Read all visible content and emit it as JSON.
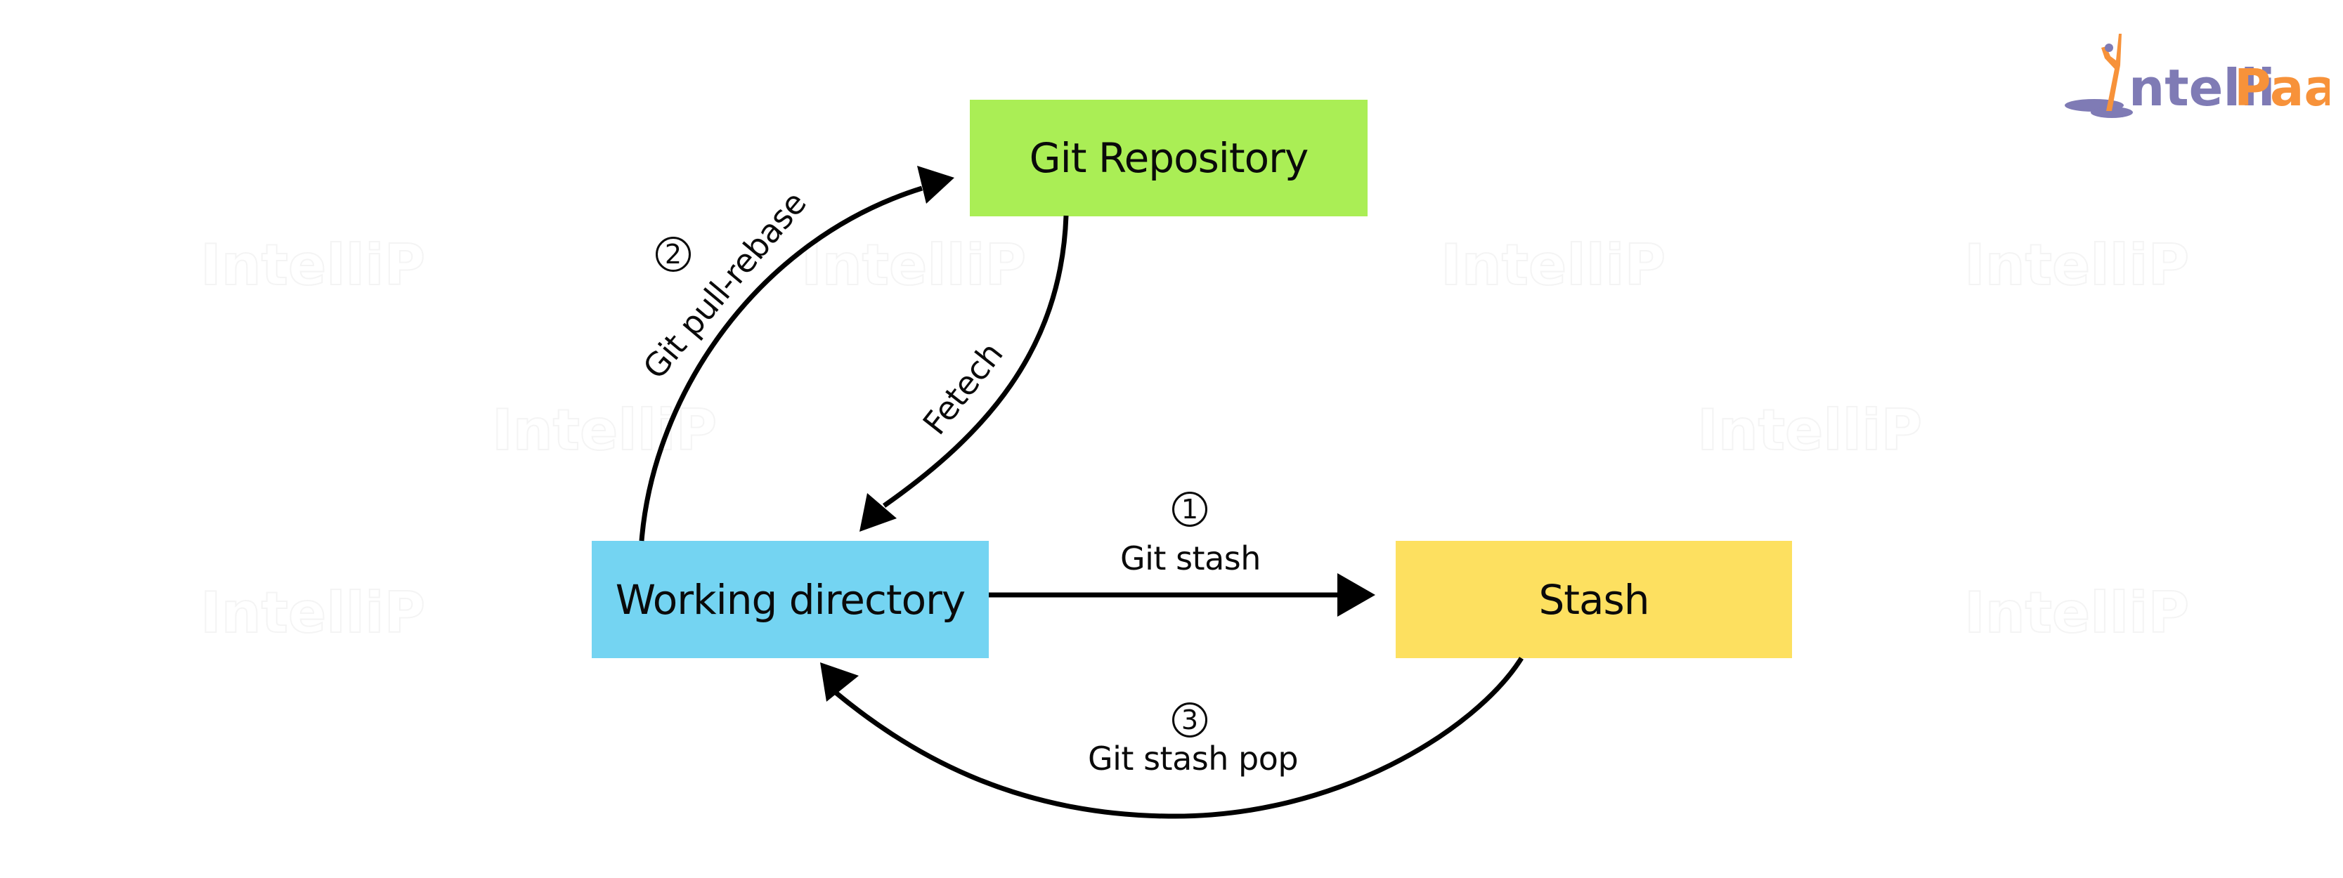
{
  "brand": {
    "name_part1": "ntelli",
    "name_part2": "Paat",
    "watermark_text": "IntelliPaat",
    "colors": {
      "purple": "#7F7BB5",
      "orange": "#F7923A"
    }
  },
  "nodes": {
    "repo": {
      "label": "Git Repository",
      "color": "#AAEE55"
    },
    "wd": {
      "label": "Working directory",
      "color": "#74D4F2"
    },
    "stash": {
      "label": "Stash",
      "color": "#FDE060"
    }
  },
  "edges": {
    "stash": {
      "step": "1",
      "label": "Git stash",
      "from": "Working directory",
      "to": "Stash"
    },
    "pullrebase": {
      "step": "2",
      "label": "Git pull-rebase",
      "from": "Working directory",
      "to": "Git Repository"
    },
    "stashpop": {
      "step": "3",
      "label": "Git stash pop",
      "from": "Stash",
      "to": "Working directory"
    },
    "fetch": {
      "step": "",
      "label": "Fetech",
      "from": "Git Repository",
      "to": "Working directory"
    }
  },
  "line_color": "#000000"
}
